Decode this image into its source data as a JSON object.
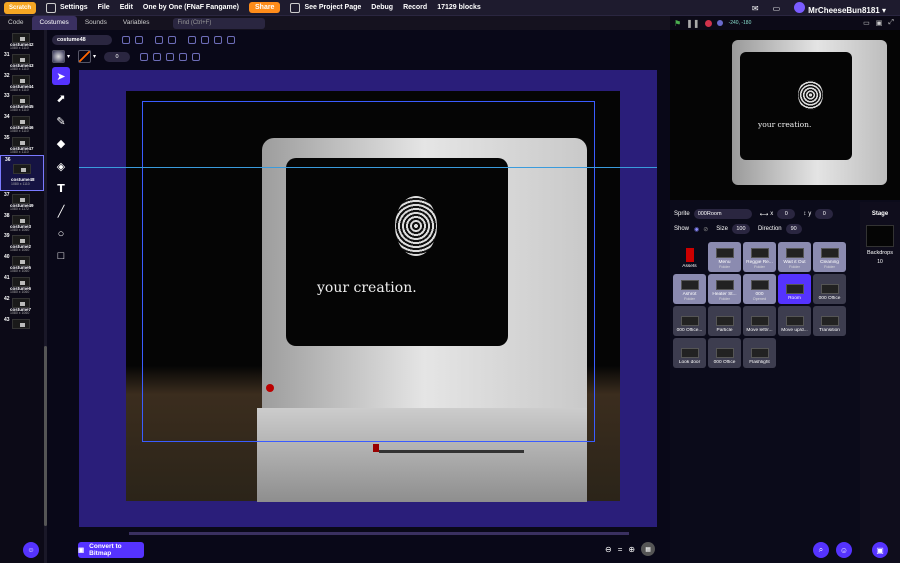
{
  "menubar": {
    "logo": "Scratch",
    "items": [
      "Settings",
      "File",
      "Edit"
    ],
    "project_title": "One by One (FNaF Fangame)",
    "share": "Share",
    "see_project": "See Project Page",
    "debug": "Debug",
    "record": "Record",
    "blocks": "17129 blocks",
    "username": "MrCheeseBun8181"
  },
  "tabs": {
    "code": "Code",
    "costumes": "Costumes",
    "sounds": "Sounds",
    "variables": "Variables",
    "find_placeholder": "Find (Ctrl+F)"
  },
  "costumes": [
    {
      "num": "",
      "name": "costume42",
      "size": "1080 x 1110"
    },
    {
      "num": "31",
      "name": "costume43",
      "size": "1080 x 1110"
    },
    {
      "num": "32",
      "name": "costume44",
      "size": "1080 x 1110"
    },
    {
      "num": "33",
      "name": "costume45",
      "size": "1080 x 1110"
    },
    {
      "num": "34",
      "name": "costume46",
      "size": "1080 x 1110"
    },
    {
      "num": "35",
      "name": "costume47",
      "size": "1080 x 1110"
    },
    {
      "num": "36",
      "name": "costume48",
      "size": "1080 x 1110"
    },
    {
      "num": "37",
      "name": "costume49",
      "size": "1080 x 1172"
    },
    {
      "num": "38",
      "name": "costume3",
      "size": "1080 x 1060"
    },
    {
      "num": "39",
      "name": "costume2",
      "size": "1080 x 1060"
    },
    {
      "num": "40",
      "name": "costume5",
      "size": "1080 x 1060"
    },
    {
      "num": "41",
      "name": "costume6",
      "size": "1080 x 1060"
    },
    {
      "num": "42",
      "name": "costume7",
      "size": "1080 x 1060"
    },
    {
      "num": "43",
      "name": "",
      "size": ""
    }
  ],
  "editor": {
    "costume_name": "costume48",
    "stroke_width": "0",
    "convert_button": "Convert to Bitmap",
    "zoom_eq": "="
  },
  "canvas": {
    "screen_text": "your creation."
  },
  "stage": {
    "coords": "-240, -180",
    "screen_text": "your creation."
  },
  "sprite_info": {
    "sprite_label": "Sprite",
    "sprite_name": "000Room",
    "x_label": "x",
    "x_value": "0",
    "y_label": "y",
    "y_value": "0",
    "show_label": "Show",
    "size_label": "Size",
    "size_value": "100",
    "direction_label": "Direction",
    "direction_value": "90"
  },
  "sprites": [
    {
      "name": "Assets",
      "sub": ""
    },
    {
      "name": "Menu",
      "sub": "Folder"
    },
    {
      "name": "Reggie Re...",
      "sub": "Folder"
    },
    {
      "name": "Wait it Out",
      "sub": "Folder"
    },
    {
      "name": "Cleaning",
      "sub": "Folder"
    },
    {
      "name": "Ashrot",
      "sub": "Folder"
    },
    {
      "name": "Heater St...",
      "sub": "Folder"
    },
    {
      "name": "000",
      "sub": "Opened"
    },
    {
      "name": "Room",
      "sub": ""
    },
    {
      "name": "000 Office",
      "sub": ""
    },
    {
      "name": "000 Office...",
      "sub": ""
    },
    {
      "name": "Particle",
      "sub": ""
    },
    {
      "name": "Move left/r...",
      "sub": ""
    },
    {
      "name": "Move up/d...",
      "sub": ""
    },
    {
      "name": "Transition",
      "sub": ""
    },
    {
      "name": "Look door",
      "sub": ""
    },
    {
      "name": "000 Office",
      "sub": ""
    },
    {
      "name": "Flashlight",
      "sub": ""
    }
  ],
  "stage_panel": {
    "label": "Stage",
    "backdrops_label": "Backdrops",
    "backdrops_count": "10"
  }
}
